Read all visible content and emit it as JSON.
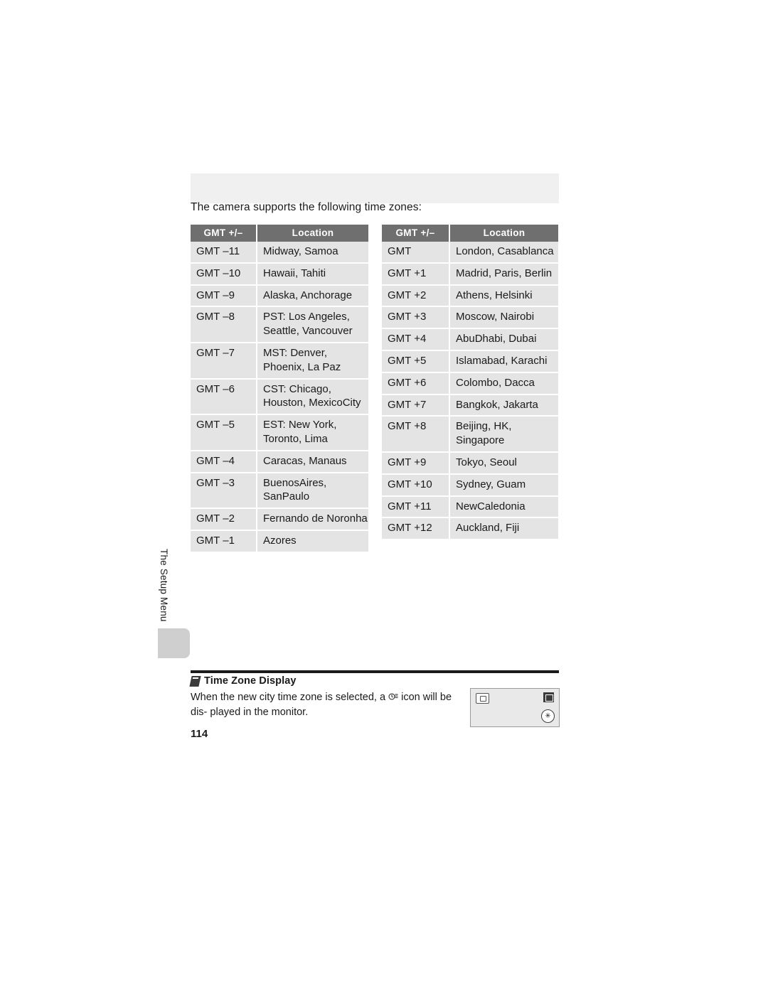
{
  "page": {
    "intro": "The camera supports the following time zones:",
    "page_number": "114",
    "side_tab_label": "The Setup Menu"
  },
  "tables": {
    "left": {
      "headers": [
        "GMT +/–",
        "Location"
      ],
      "rows": [
        {
          "gmt": "GMT –11",
          "location": "Midway, Samoa"
        },
        {
          "gmt": "GMT –10",
          "location": "Hawaii, Tahiti"
        },
        {
          "gmt": "GMT –9",
          "location": "Alaska, Anchorage"
        },
        {
          "gmt": "GMT –8",
          "location": "PST: Los Angeles,\nSeattle, Vancouver"
        },
        {
          "gmt": "GMT –7",
          "location": "MST: Denver,\nPhoenix, La Paz"
        },
        {
          "gmt": "GMT –6",
          "location": "CST: Chicago,\nHouston, MexicoCity"
        },
        {
          "gmt": "GMT –5",
          "location": "EST: New York,\nToronto, Lima"
        },
        {
          "gmt": "GMT –4",
          "location": "Caracas, Manaus"
        },
        {
          "gmt": "GMT –3",
          "location": "BuenosAires,\nSanPaulo"
        },
        {
          "gmt": "GMT –2",
          "location": "Fernando de Noronha"
        },
        {
          "gmt": "GMT –1",
          "location": "Azores"
        }
      ]
    },
    "right": {
      "headers": [
        "GMT +/–",
        "Location"
      ],
      "rows": [
        {
          "gmt": "GMT",
          "location": "London, Casablanca"
        },
        {
          "gmt": "GMT +1",
          "location": "Madrid, Paris, Berlin"
        },
        {
          "gmt": "GMT +2",
          "location": "Athens, Helsinki"
        },
        {
          "gmt": "GMT +3",
          "location": "Moscow, Nairobi"
        },
        {
          "gmt": "GMT +4",
          "location": "AbuDhabi, Dubai"
        },
        {
          "gmt": "GMT +5",
          "location": "Islamabad, Karachi"
        },
        {
          "gmt": "GMT +6",
          "location": "Colombo, Dacca"
        },
        {
          "gmt": "GMT +7",
          "location": "Bangkok, Jakarta"
        },
        {
          "gmt": "GMT +8",
          "location": "Beijing, HK, Singapore"
        },
        {
          "gmt": "GMT +9",
          "location": "Tokyo, Seoul"
        },
        {
          "gmt": "GMT +10",
          "location": "Sydney, Guam"
        },
        {
          "gmt": "GMT +11",
          "location": "NewCaledonia"
        },
        {
          "gmt": "GMT +12",
          "location": "Auckland, Fiji"
        }
      ]
    }
  },
  "note": {
    "title": "Time Zone Display",
    "text_before": "When the new city time zone is selected, a",
    "text_after": "icon will be dis-",
    "text_line2": "played in the monitor.",
    "icon_name": "travel-clock-icon"
  },
  "monitor": {
    "badge_label": "✳",
    "left_icon": "picture-icon",
    "right_icon": "mode-icon"
  },
  "colors": {
    "header_bg": "#6f6f6f",
    "cell_bg": "#e4e4e4",
    "banner_bg": "#f0f0f0",
    "text": "#1a1a1a"
  }
}
